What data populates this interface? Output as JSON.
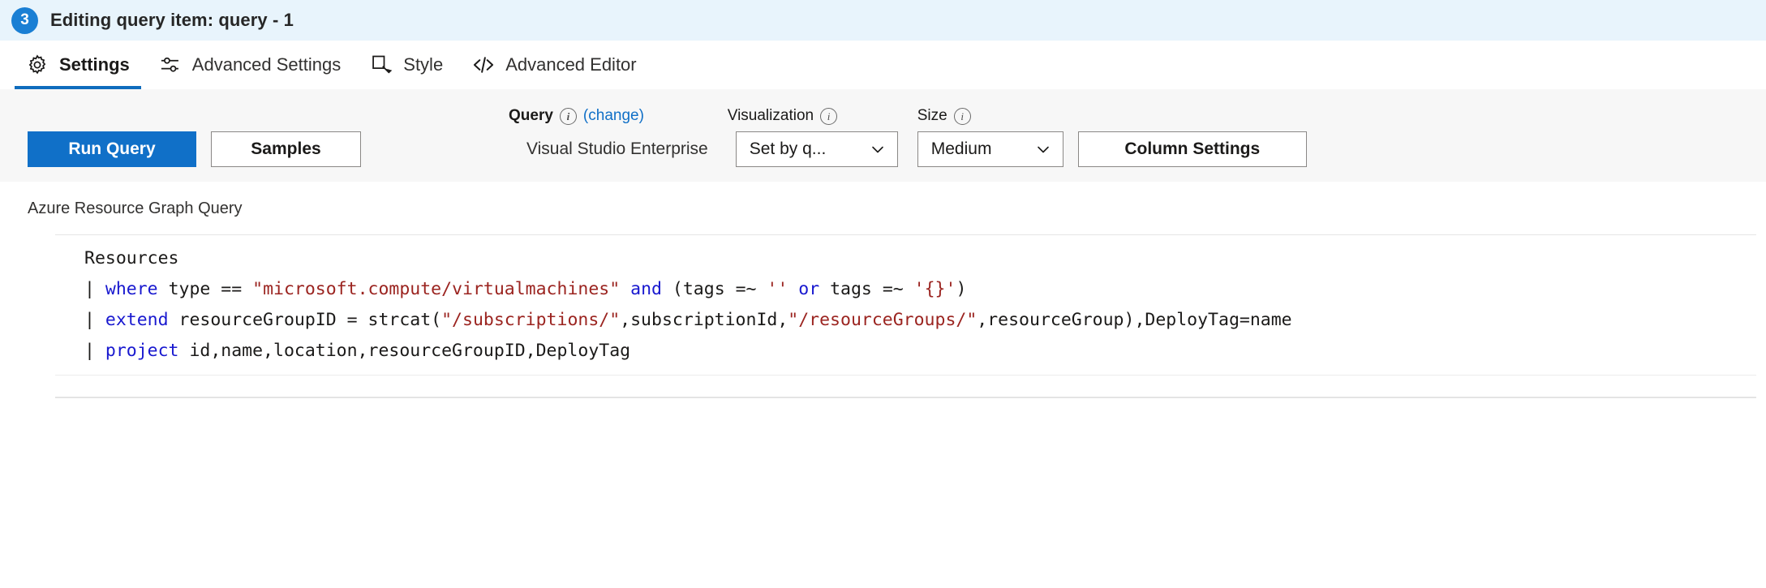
{
  "header": {
    "step_number": "3",
    "title": "Editing query item: query - 1",
    "background_color": "#e8f4fc",
    "badge_color": "#1a7fd4"
  },
  "tabs": [
    {
      "label": "Settings",
      "icon": "gear-icon",
      "active": true
    },
    {
      "label": "Advanced Settings",
      "icon": "sliders-icon",
      "active": false
    },
    {
      "label": "Style",
      "icon": "style-cursor-icon",
      "active": false
    },
    {
      "label": "Advanced Editor",
      "icon": "code-brackets-icon",
      "active": false
    }
  ],
  "toolbar": {
    "run_query_label": "Run Query",
    "samples_label": "Samples",
    "query_label": "Query",
    "change_link": "(change)",
    "data_source": "Visual Studio Enterprise",
    "visualization_label": "Visualization",
    "visualization_value": "Set by q...",
    "size_label": "Size",
    "size_value": "Medium",
    "column_settings_label": "Column Settings",
    "primary_button_color": "#1070c8",
    "link_color": "#1170c7"
  },
  "query": {
    "caption": "Azure Resource Graph Query",
    "keyword_color": "#1818cf",
    "string_color": "#9b2420",
    "lines": [
      {
        "tokens": [
          {
            "t": "Resources",
            "c": "plain"
          }
        ]
      },
      {
        "tokens": [
          {
            "t": "| ",
            "c": "pipe"
          },
          {
            "t": "where",
            "c": "kw"
          },
          {
            "t": " type == ",
            "c": "plain"
          },
          {
            "t": "\"microsoft.compute/virtualmachines\"",
            "c": "str"
          },
          {
            "t": " ",
            "c": "plain"
          },
          {
            "t": "and",
            "c": "kw"
          },
          {
            "t": " (tags =~ ",
            "c": "plain"
          },
          {
            "t": "''",
            "c": "str"
          },
          {
            "t": " ",
            "c": "plain"
          },
          {
            "t": "or",
            "c": "kw"
          },
          {
            "t": " tags =~ ",
            "c": "plain"
          },
          {
            "t": "'{}'",
            "c": "str"
          },
          {
            "t": ")",
            "c": "plain"
          }
        ]
      },
      {
        "tokens": [
          {
            "t": "| ",
            "c": "pipe"
          },
          {
            "t": "extend",
            "c": "kw"
          },
          {
            "t": " resourceGroupID = strcat(",
            "c": "plain"
          },
          {
            "t": "\"/subscriptions/\"",
            "c": "str"
          },
          {
            "t": ",subscriptionId,",
            "c": "plain"
          },
          {
            "t": "\"/resourceGroups/\"",
            "c": "str"
          },
          {
            "t": ",resourceGroup),DeployTag=name",
            "c": "plain"
          }
        ]
      },
      {
        "tokens": [
          {
            "t": "| ",
            "c": "pipe"
          },
          {
            "t": "project",
            "c": "kw"
          },
          {
            "t": " id,name,location,resourceGroupID,DeployTag",
            "c": "plain"
          }
        ]
      }
    ]
  }
}
